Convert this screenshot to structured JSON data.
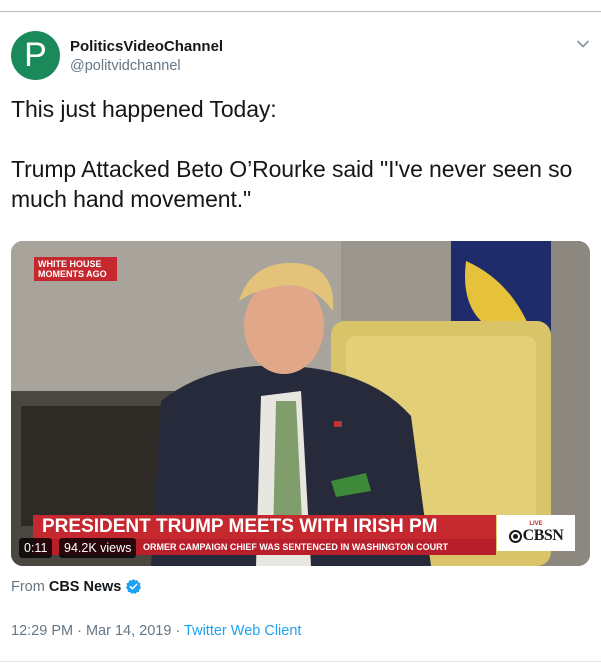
{
  "user": {
    "avatar_letter": "P",
    "display_name": "PoliticsVideoChannel",
    "handle": "@politvidchannel"
  },
  "tweet": {
    "lines": [
      "This just happened Today:",
      "Trump Attacked Beto O’Rourke said \"I've never seen so",
      "much hand movement.\""
    ]
  },
  "video": {
    "badge": "WHITE HOUSE MOMENTS AGO",
    "headline": "PRESIDENT TRUMP MEETS WITH IRISH PM",
    "ticker": "ORMER CAMPAIGN CHIEF WAS SENTENCED IN WASHINGTON COURT",
    "network_live": "LIVE",
    "network_logo": "CBSN",
    "duration": "0:11",
    "views": "94.2K views"
  },
  "source": {
    "prefix": "From",
    "name": "CBS News"
  },
  "meta": {
    "time": "12:29 PM",
    "separator": " · ",
    "date": "Mar 14, 2019",
    "client": "Twitter Web Client"
  },
  "icons": {
    "caret": "chevron-down-icon",
    "verified": "verified-badge-icon"
  },
  "colors": {
    "avatar_bg": "#1a8a5a",
    "link": "#1da1f2",
    "secondary_text": "#657786",
    "cbs_red": "#c5282f"
  }
}
